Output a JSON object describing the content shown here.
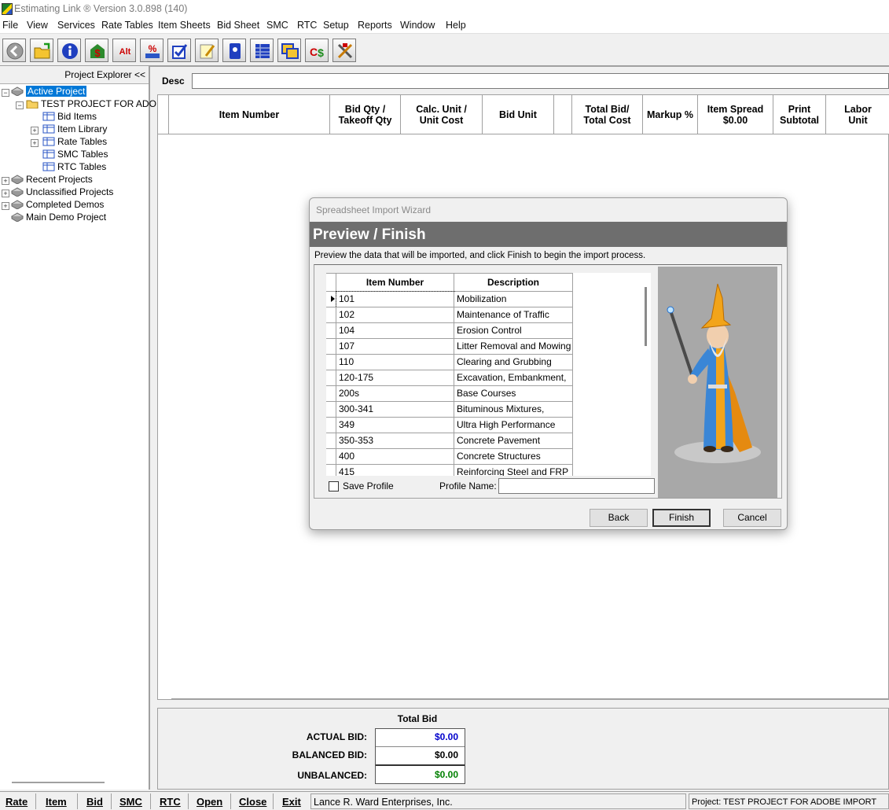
{
  "window": {
    "title": "Estimating Link ® Version  3.0.898 (140)"
  },
  "menu": [
    "File",
    "View",
    "Services",
    "Rate Tables",
    "Item Sheets",
    "Bid Sheet",
    "SMC",
    "RTC",
    "Setup",
    "Reports",
    "Window",
    "Help"
  ],
  "toolbar": {
    "icons": [
      "back-icon",
      "open-folder-icon",
      "info-icon",
      "dollar-icon",
      "alt-icon",
      "percent-icon",
      "checklist-icon",
      "notepad-icon",
      "book-icon",
      "spreadsheet-icon",
      "windows-icon",
      "cost-dollar-icon",
      "tools-icon"
    ],
    "alt_label": "Alt"
  },
  "explorer": {
    "header": "Project Explorer <<",
    "active_project": "Active Project",
    "project_name": "TEST PROJECT FOR ADO",
    "children": [
      "Bid Items",
      "Item Library",
      "Rate Tables",
      "SMC Tables",
      "RTC Tables"
    ],
    "groups": [
      "Recent Projects",
      "Unclassified Projects",
      "Completed Demos",
      "Main Demo Project"
    ]
  },
  "desc": {
    "label": "Desc",
    "value": ""
  },
  "grid": {
    "headers": {
      "item_number": "Item Number",
      "bid_qty_1": "Bid Qty /",
      "bid_qty_2": "Takeoff Qty",
      "calc_1": "Calc. Unit /",
      "calc_2": "Unit Cost",
      "bid_unit": "Bid Unit",
      "total_1": "Total Bid/",
      "total_2": "Total Cost",
      "markup": "Markup %",
      "spread_1": "Item Spread",
      "spread_2": "$0.00",
      "print_1": "Print",
      "print_2": "Subtotal",
      "labor_1": "Labor",
      "labor_2": "Unit"
    }
  },
  "totals": {
    "title": "Total Bid",
    "actual_label": "ACTUAL BID:",
    "actual_value": "$0.00",
    "balanced_label": "BALANCED BID:",
    "balanced_value": "$0.00",
    "unbalanced_label": "UNBALANCED:",
    "unbalanced_value": "$0.00",
    "colors": {
      "actual": "#0000cc",
      "balanced": "#000000",
      "unbalanced": "#008000"
    }
  },
  "statusbar": {
    "buttons": [
      "Rate",
      "Item",
      "Bid",
      "SMC",
      "RTC",
      "Open",
      "Close",
      "Exit"
    ],
    "company": "Lance R. Ward Enterprises, Inc.",
    "project": "Project: TEST PROJECT FOR ADOBE IMPORT"
  },
  "dialog": {
    "title": "Spreadsheet Import Wizard",
    "banner": "Preview / Finish",
    "description": "Preview the data that will be imported, and click Finish to begin the import process.",
    "columns": [
      "Item Number",
      "Description"
    ],
    "rows": [
      {
        "item": "101",
        "desc": "Mobilization"
      },
      {
        "item": "102",
        "desc": "Maintenance of Traffic"
      },
      {
        "item": "104",
        "desc": "Erosion Control"
      },
      {
        "item": "107",
        "desc": "Litter Removal and Mowing"
      },
      {
        "item": "110",
        "desc": "Clearing and Grubbing"
      },
      {
        "item": "120-175",
        "desc": "Excavation, Embankment,"
      },
      {
        "item": "200s",
        "desc": "Base Courses"
      },
      {
        "item": "300-341",
        "desc": "Bituminous Mixtures,"
      },
      {
        "item": "349",
        "desc": "Ultra High Performance"
      },
      {
        "item": "350-353",
        "desc": "Concrete Pavement"
      },
      {
        "item": "400",
        "desc": "Concrete Structures"
      },
      {
        "item": "415",
        "desc": "Reinforcing Steel and FRP"
      }
    ],
    "save_profile_label": "Save Profile",
    "save_profile_checked": false,
    "profile_name_label": "Profile Name:",
    "profile_name_value": "",
    "back_label": "Back",
    "finish_label": "Finish",
    "cancel_label": "Cancel"
  }
}
